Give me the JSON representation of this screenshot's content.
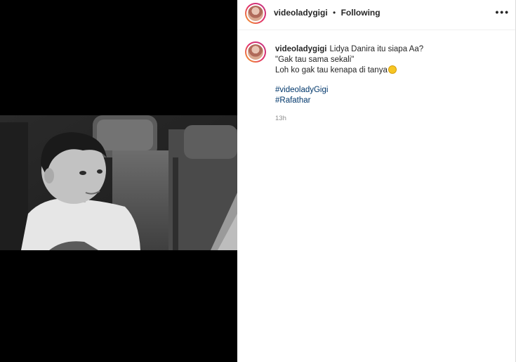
{
  "post": {
    "username": "videoladygigi",
    "separator": "•",
    "follow_status": "Following",
    "more_icon": "more-horizontal-icon",
    "caption_line1": "Lidya Danira itu siapa Aa?",
    "caption_line2": "\"Gak tau sama sekali\"",
    "caption_line3": "Loh ko gak tau kenapa di tanya",
    "caption_emoji": "rolling-on-floor-laughing-emoji",
    "hashtags": [
      "#videoladyGigi",
      "#Rafathar"
    ],
    "timestamp": "13h"
  },
  "colors": {
    "link": "#00376b",
    "secondary_text": "#8e8e8e",
    "media_background": "#000000"
  }
}
